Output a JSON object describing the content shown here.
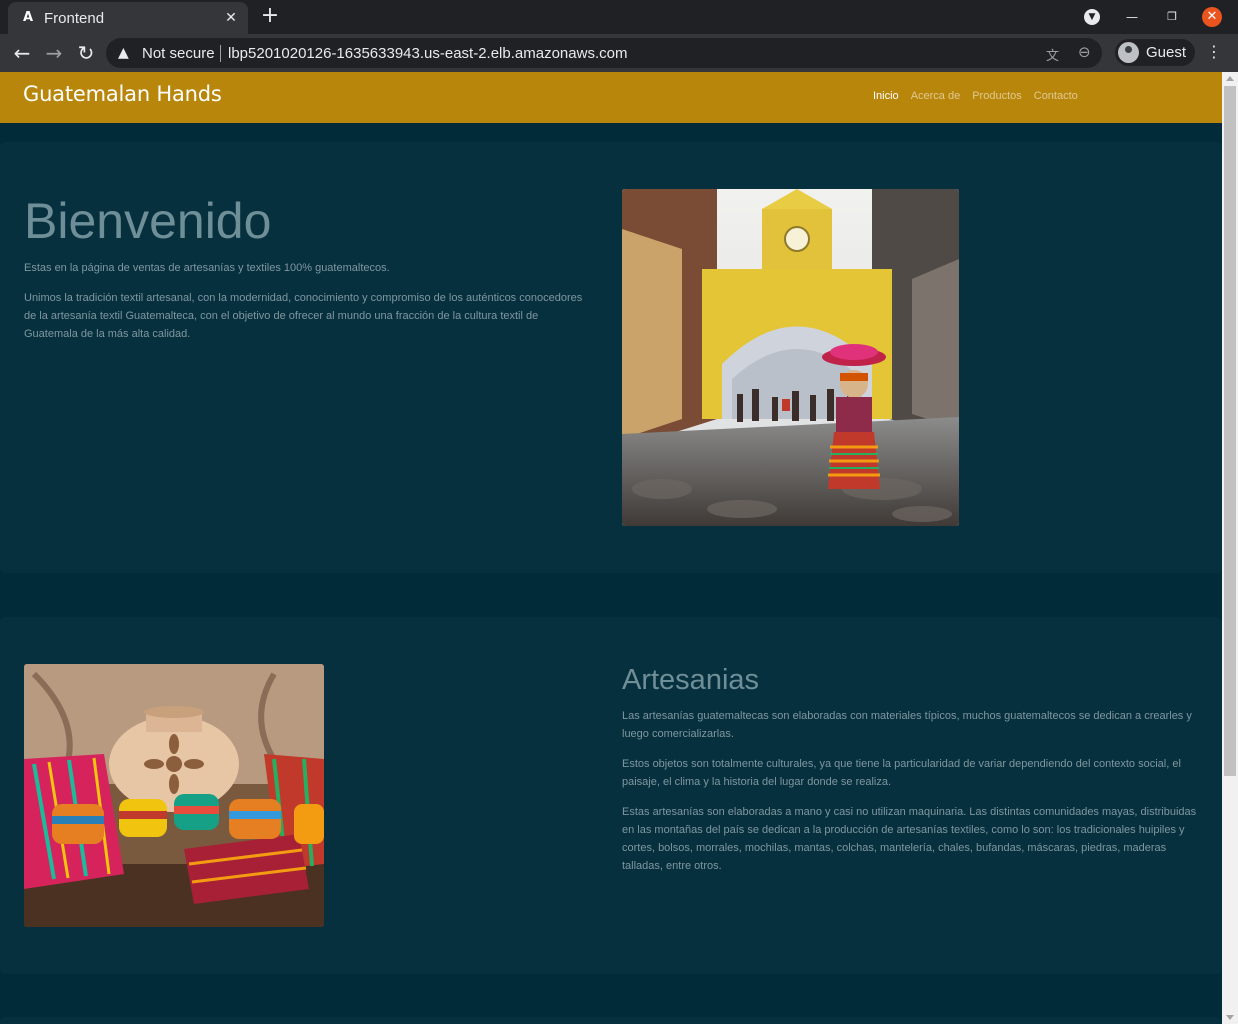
{
  "browser": {
    "tab_title": "Frontend",
    "tab_favicon": "A",
    "security_label": "Not secure",
    "url": "lbp5201020126-1635633943.us-east-2.elb.amazonaws.com",
    "profile_name": "Guest",
    "icons": {
      "close_tab": "close-icon",
      "new_tab": "plus-icon",
      "tab_search": "chevron-down-icon",
      "back": "arrow-left-icon",
      "forward": "arrow-right-icon",
      "reload": "reload-icon",
      "warning": "warning-icon",
      "translate": "translate-icon",
      "zoom": "zoom-icon",
      "menu": "kebab-menu-icon"
    }
  },
  "navbar": {
    "brand": "Guatemalan Hands",
    "links": [
      "Inicio",
      "Acerca de",
      "Productos",
      "Contacto"
    ],
    "active_index": 0,
    "background": "#b8860b"
  },
  "hero": {
    "title": "Bienvenido",
    "intro": "Estas en la página de ventas de artesanías y textiles 100% guatemaltecos.",
    "description": "Unimos la tradición textil artesanal, con la modernidad, conocimiento y compromiso de los auténticos conocedores de la artesanía textil Guatemalteca, con el objetivo de ofrecer al mundo una fracción de la cultura textil de Guatemala de la más alta calidad."
  },
  "artesanias": {
    "title": "Artesanias",
    "paragraphs": [
      "Las artesanías guatemaltecas son elaboradas con materiales típicos, muchos guatemaltecos se dedican a crearles y luego comercializarlas.",
      "Estos objetos son totalmente culturales, ya que tiene la particularidad de variar dependiendo del contexto social, el paisaje, el clima y la historia del lugar donde se realiza.",
      "Estas artesanías son elaboradas a mano y casi no utilizan maquinaria. Las distintas comunidades mayas, distribuidas en las montañas del país se dedican a la producción de artesanías textiles, como lo son: los tradicionales huipiles y cortes, bolsos, morrales, mochilas, mantas, colchas, mantelería, chales, bufandas, máscaras, piedras, maderas talladas, entre otros."
    ]
  },
  "colors": {
    "page_background": "#022b3a",
    "section_background": "#07303f",
    "heading_text": "#6f8f98",
    "body_text": "#7f979f"
  }
}
